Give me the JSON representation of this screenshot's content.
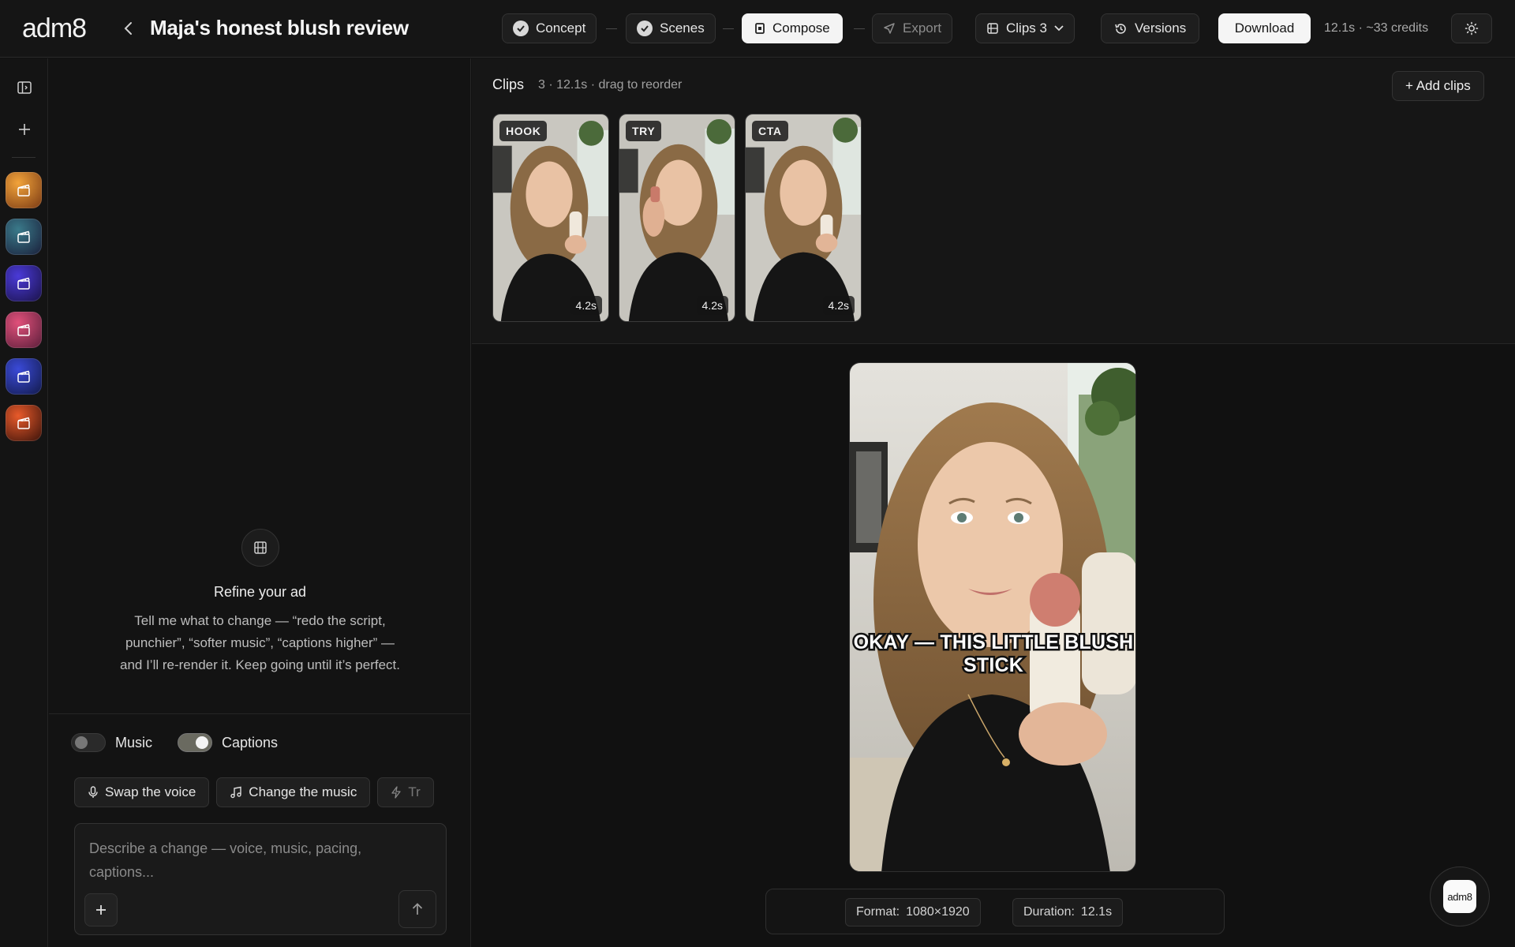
{
  "app": {
    "logo": "adm8",
    "title": "Maja's honest blush review"
  },
  "steps": [
    {
      "label": "Concept",
      "state": "done"
    },
    {
      "label": "Scenes",
      "state": "done"
    },
    {
      "label": "Compose",
      "state": "active"
    },
    {
      "label": "Export",
      "state": "pending"
    }
  ],
  "toolbar": {
    "clips_label": "Clips 3",
    "versions_label": "Versions",
    "download_label": "Download",
    "credits": "12.1s · ~33 credits"
  },
  "chat": {
    "empty_title": "Refine your ad",
    "empty_text": "Tell me what to change — “redo the script, punchier”, “softer music”, “captions higher” — and I’ll re-render it. Keep going until it’s perfect.",
    "toggles": [
      {
        "label": "Music",
        "on": false
      },
      {
        "label": "Captions",
        "on": true
      }
    ],
    "suggestions": [
      "Swap the voice",
      "Change the music",
      "Tr"
    ],
    "composer_placeholder": "Describe a change — voice, music, pacing, captions..."
  },
  "clips": {
    "title": "Clips",
    "meta": "3 · 12.1s · drag to reorder",
    "add_label": "+ Add clips",
    "items": [
      {
        "tag": "HOOK",
        "duration": "4.2s"
      },
      {
        "tag": "TRY",
        "duration": "4.2s"
      },
      {
        "tag": "CTA",
        "duration": "4.2s"
      }
    ]
  },
  "preview": {
    "caption": "OKAY — THIS LITTLE BLUSH STICK",
    "format_label": "Format:",
    "format_value": "1080×1920",
    "duration_label": "Duration:",
    "duration_value": "12.1s"
  },
  "fab": {
    "label": "adm8"
  },
  "colors": {
    "background": "#111111",
    "surface": "#1e1e1e",
    "accent": "#f4f4f4",
    "border": "#333333",
    "muted_text": "#a0a0a0"
  },
  "project_thumbnails": [
    {
      "icon": "clapperboard-icon",
      "gradient": [
        "#f2a33a",
        "#7a3a14"
      ]
    },
    {
      "icon": "clapperboard-icon",
      "gradient": [
        "#3a7a8a",
        "#1a1f3a"
      ]
    },
    {
      "icon": "clapperboard-icon",
      "gradient": [
        "#4a3ad8",
        "#1a1248"
      ]
    },
    {
      "icon": "clapperboard-icon",
      "gradient": [
        "#e0507a",
        "#5a1e3a"
      ]
    },
    {
      "icon": "clapperboard-icon",
      "gradient": [
        "#3a4ad8",
        "#121a4a"
      ]
    },
    {
      "icon": "clapperboard-icon",
      "gradient": [
        "#e85a2a",
        "#3a120a"
      ]
    }
  ]
}
